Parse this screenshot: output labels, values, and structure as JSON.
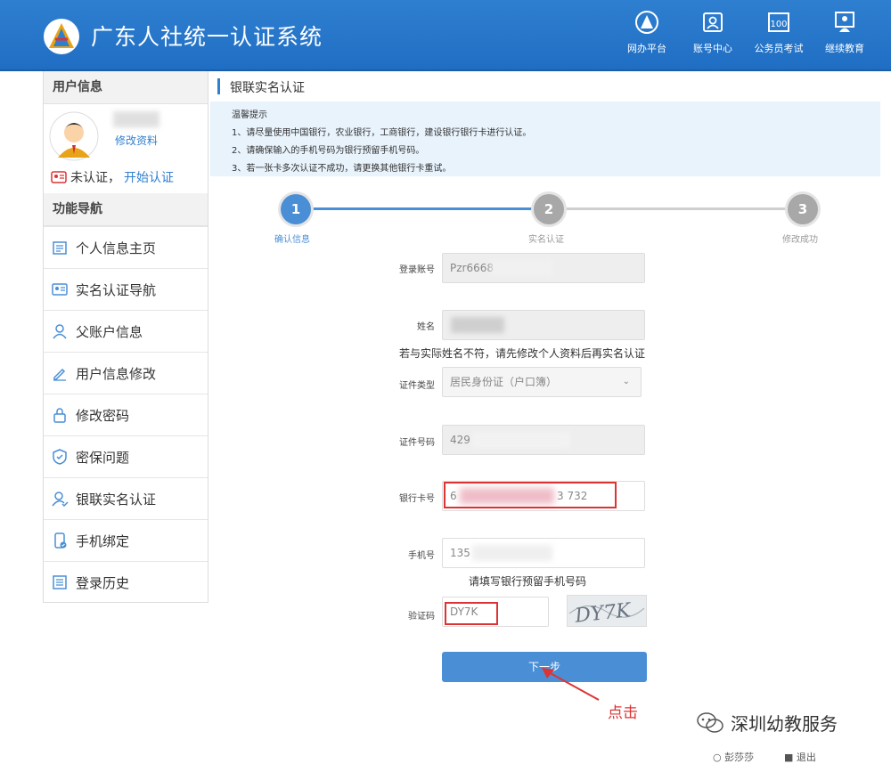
{
  "header": {
    "title": "广东人社统一认证系统",
    "nav": [
      {
        "label": "网办平台",
        "icon": "emblem-icon"
      },
      {
        "label": "账号中心",
        "icon": "id-card-icon"
      },
      {
        "label": "公务员考试",
        "icon": "exam-icon"
      },
      {
        "label": "继续教育",
        "icon": "teacher-icon"
      }
    ]
  },
  "sidebar": {
    "user_title": "用户信息",
    "edit_profile": "修改资料",
    "cert_status": "未认证，",
    "cert_link": "开始认证",
    "nav_title": "功能导航",
    "items": [
      {
        "label": "个人信息主页",
        "icon": "home-icon"
      },
      {
        "label": "实名认证导航",
        "icon": "id-card-icon"
      },
      {
        "label": "父账户信息",
        "icon": "user-icon"
      },
      {
        "label": "用户信息修改",
        "icon": "pencil-icon"
      },
      {
        "label": "修改密码",
        "icon": "lock-icon"
      },
      {
        "label": "密保问题",
        "icon": "shield-icon"
      },
      {
        "label": "银联实名认证",
        "icon": "user-check-icon"
      },
      {
        "label": "手机绑定",
        "icon": "phone-icon"
      },
      {
        "label": "登录历史",
        "icon": "list-icon"
      }
    ]
  },
  "main": {
    "breadcrumb": "银联实名认证",
    "tips": {
      "title": "温馨提示",
      "lines": [
        "1、请尽量使用中国银行，农业银行，工商银行，建设银行银行卡进行认证。",
        "2、请确保输入的手机号码为银行预留手机号码。",
        "3、若一张卡多次认证不成功，请更换其他银行卡重试。"
      ]
    },
    "steps": [
      {
        "num": "1",
        "label": "确认信息",
        "status": "active"
      },
      {
        "num": "2",
        "label": "实名认证",
        "status": "pending"
      },
      {
        "num": "3",
        "label": "修改成功",
        "status": "pending"
      }
    ],
    "form": {
      "account_label": "登录账号",
      "account_value": "Pzr6668",
      "name_label": "姓名",
      "name_hint": "若与实际姓名不符，请先修改个人资料后再实名认证",
      "id_type_label": "证件类型",
      "id_type_value": "居民身份证（户口簿）",
      "id_number_label": "证件号码",
      "id_number_value": "429",
      "bank_card_label": "银行卡号",
      "bank_card_prefix": "6",
      "bank_card_suffix": "3 732",
      "phone_label": "手机号",
      "phone_value": "135",
      "phone_hint": "请填写银行预留手机号码",
      "captcha_label": "验证码",
      "captcha_value": "DY7K",
      "captcha_image_text": "DY7K",
      "next_button": "下一步"
    },
    "annotation_click": "点击",
    "watermark": "深圳幼教服务",
    "footer_left": "彭莎莎",
    "footer_right": "退出"
  },
  "colors": {
    "header_blue": "#1f6ec4",
    "active_step": "#4a8fd6",
    "pending_step": "#a8a8a8",
    "highlight_red": "#d33333"
  }
}
